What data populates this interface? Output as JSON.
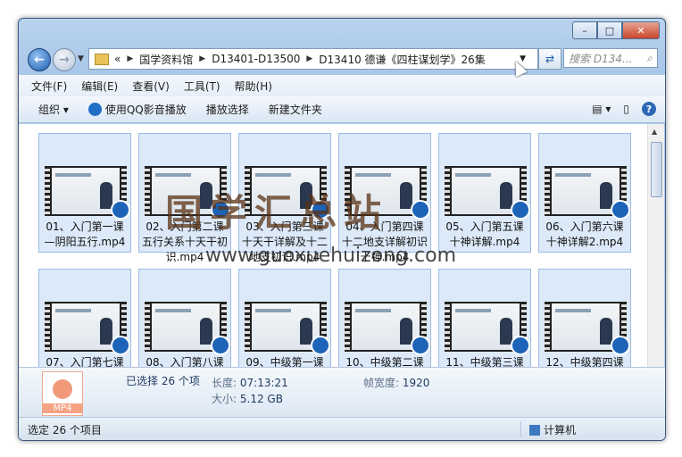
{
  "window_controls": {
    "minimize": "–",
    "maximize": "□",
    "close": "✕"
  },
  "navbar": {
    "breadcrumb_overflow": "«",
    "breadcrumb": [
      "国学资料馆",
      "D13401-D13500",
      "D13410 德谦《四柱谋划学》26集"
    ],
    "search_placeholder": "搜索 D134..."
  },
  "menu": [
    "文件(F)",
    "编辑(E)",
    "查看(V)",
    "工具(T)",
    "帮助(H)"
  ],
  "toolbar": {
    "organize": "组织 ▾",
    "play_qq": "使用QQ影音播放",
    "play_select": "播放选择",
    "new_folder": "新建文件夹"
  },
  "files": [
    {
      "label": "01、入门第一课—阴阳五行.mp4"
    },
    {
      "label": "02、入门第二课五行关系十天干初识.mp4"
    },
    {
      "label": "03、入门第三课十天干详解及十二地支初识.mp4"
    },
    {
      "label": "04、入门第四课十二地支详解初识十神.mp4"
    },
    {
      "label": "05、入门第五课十神详解.mp4"
    },
    {
      "label": "06、入门第六课十神详解2.mp4"
    },
    {
      "label": "07、入门第七课"
    },
    {
      "label": "08、入门第八课"
    },
    {
      "label": "09、中级第一课"
    },
    {
      "label": "10、中级第二课"
    },
    {
      "label": "11、中级第三课"
    },
    {
      "label": "12、中级第四课"
    }
  ],
  "details": {
    "icon_text": "MP4",
    "selected": "已选择 26 个项",
    "length_label": "长度:",
    "length": "07:13:21",
    "frame_width_label": "帧宽度:",
    "frame_width": "1920",
    "size_label": "大小:",
    "size": "5.12 GB"
  },
  "status": {
    "left": "选定 26 个项目",
    "right": "计算机"
  },
  "watermark": {
    "cn": "国学汇总站",
    "url": "www.guoxuehuizong.com"
  }
}
